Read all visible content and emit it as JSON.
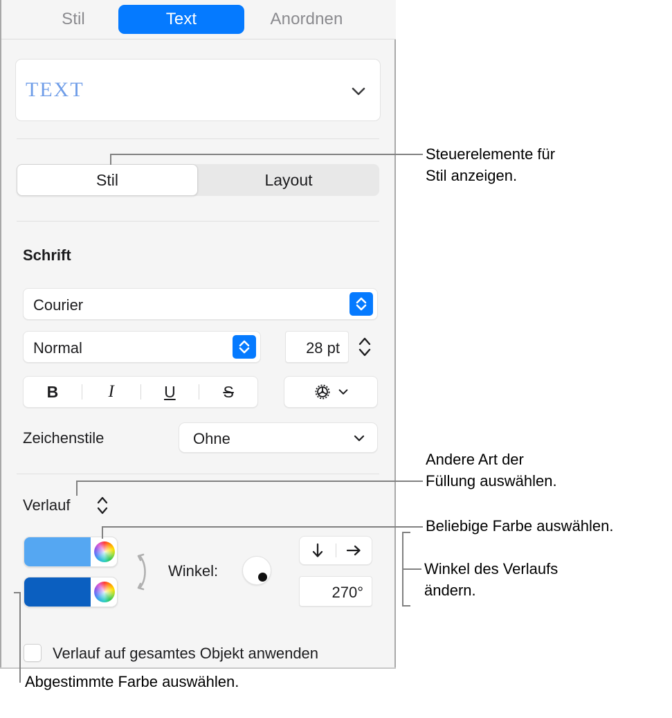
{
  "panel": {
    "tabs": [
      {
        "label": "Stil",
        "selected": false
      },
      {
        "label": "Text",
        "selected": true
      },
      {
        "label": "Anordnen",
        "selected": false
      }
    ],
    "preview": {
      "sample_text": "TEXT",
      "chevron_icon": "chevron-down-icon"
    },
    "segmented": [
      {
        "label": "Stil",
        "selected": true
      },
      {
        "label": "Layout",
        "selected": false
      }
    ],
    "font_section": {
      "heading": "Schrift",
      "family": "Courier",
      "style": "Normal",
      "size": "28 pt",
      "format_buttons": [
        {
          "name": "bold",
          "label": "B"
        },
        {
          "name": "italic",
          "label": "I"
        },
        {
          "name": "underline",
          "label": "U"
        },
        {
          "name": "strikethrough",
          "label": "S"
        }
      ],
      "options_icon": "gear-icon",
      "options_chevron_icon": "chevron-down-icon",
      "character_styles_label": "Zeichenstile",
      "character_styles_value": "Ohne"
    },
    "fill_section": {
      "fill_type": "Verlauf",
      "fill_type_stepper_icon": "up-down-stepper-icon",
      "color_start": "#55a7f2",
      "color_end": "#0b5fc0",
      "color_wheel_icon": "color-wheel-icon",
      "swap_icon": "swap-colors-icon",
      "angle_label": "Winkel:",
      "angle_value": "270°",
      "angle_dial_icon": "angle-dial-icon",
      "direction_down_icon": "arrow-down-icon",
      "direction_right_icon": "arrow-right-icon",
      "checkbox_label": "Verlauf auf gesamtes Objekt anwenden",
      "checkbox_checked": false
    }
  },
  "callouts": [
    {
      "id": "style-controls",
      "text": "Steuerelemente für\nStil anzeigen."
    },
    {
      "id": "fill-type",
      "text": "Andere Art der\nFüllung auswählen."
    },
    {
      "id": "any-color",
      "text": "Beliebige Farbe auswählen."
    },
    {
      "id": "gradient-angle",
      "text": "Winkel des Verlaufs\nändern."
    },
    {
      "id": "matched-color",
      "text": "Abgestimmte Farbe auswählen."
    }
  ],
  "colors": {
    "accent": "#057aff",
    "panel_bg": "#f5f5f5",
    "leader_line": "#808080",
    "preview_text": "#6f9de8"
  }
}
